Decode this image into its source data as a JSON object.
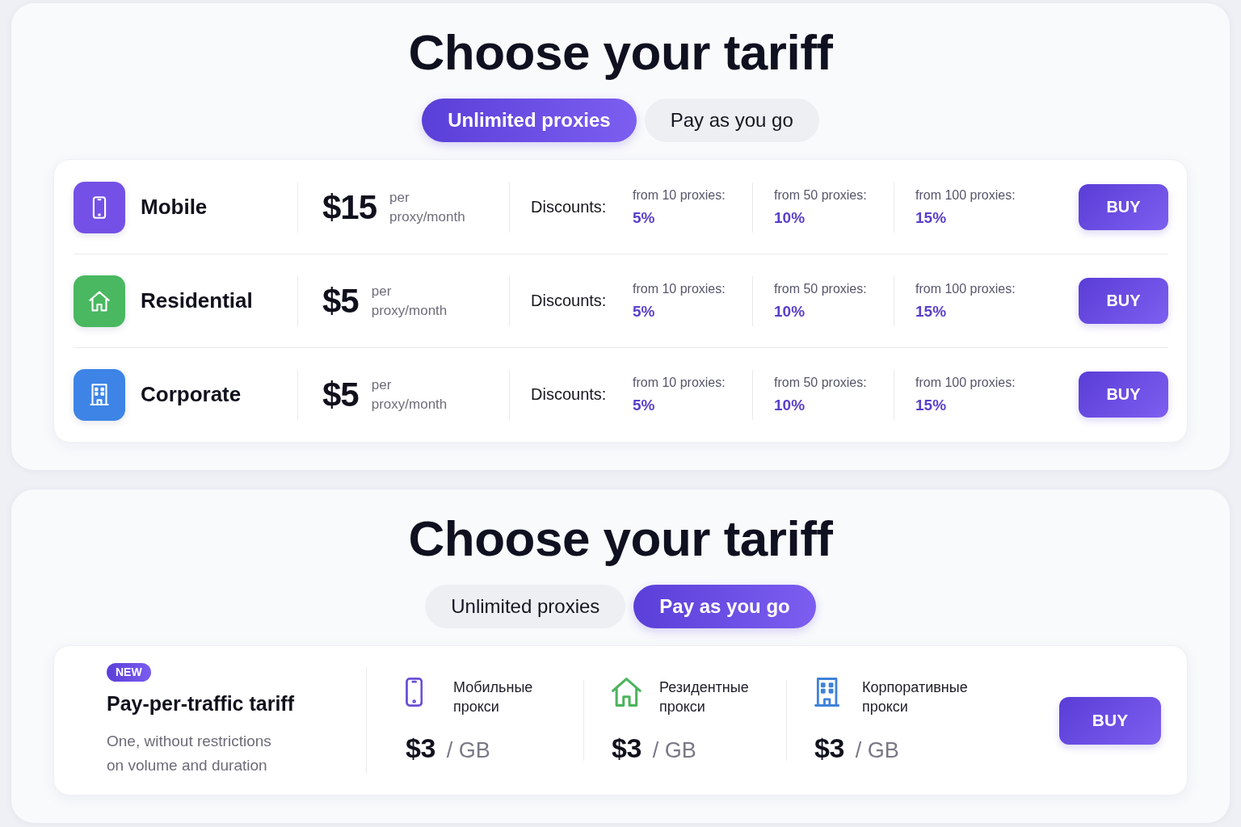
{
  "panels": [
    {
      "title": "Choose your tariff",
      "tabs": [
        {
          "label": "Unlimited proxies",
          "selected": true
        },
        {
          "label": "Pay as you go",
          "selected": false
        }
      ],
      "plans": [
        {
          "kind": "mobile",
          "color": "#7450e6",
          "name": "Mobile",
          "price": "$15",
          "period": "per proxy/month",
          "discounts_label": "Discounts:",
          "discounts": [
            {
              "threshold": "from 10 proxies:",
              "value": "5%"
            },
            {
              "threshold": "from 50 proxies:",
              "value": "10%"
            },
            {
              "threshold": "from 100 proxies:",
              "value": "15%"
            }
          ],
          "button": "BUY"
        },
        {
          "kind": "residential",
          "color": "#49b860",
          "name": "Residential",
          "price": "$5",
          "period": "per proxy/month",
          "discounts_label": "Discounts:",
          "discounts": [
            {
              "threshold": "from 10 proxies:",
              "value": "5%"
            },
            {
              "threshold": "from 50 proxies:",
              "value": "10%"
            },
            {
              "threshold": "from 100 proxies:",
              "value": "15%"
            }
          ],
          "button": "BUY"
        },
        {
          "kind": "corporate",
          "color": "#3d84e6",
          "name": "Corporate",
          "price": "$5",
          "period": "per proxy/month",
          "discounts_label": "Discounts:",
          "discounts": [
            {
              "threshold": "from 10 proxies:",
              "value": "5%"
            },
            {
              "threshold": "from 50 proxies:",
              "value": "10%"
            },
            {
              "threshold": "from 100 proxies:",
              "value": "15%"
            }
          ],
          "button": "BUY"
        }
      ]
    },
    {
      "title": "Choose your tariff",
      "tabs": [
        {
          "label": "Unlimited proxies",
          "selected": false
        },
        {
          "label": "Pay as you go",
          "selected": true
        }
      ],
      "offer": {
        "badge": "NEW",
        "title": "Pay-per-traffic tariff",
        "description": "One, without restrictions on volume and duration",
        "types": [
          {
            "kind": "mobile",
            "color": "#6a4fd6",
            "name": "Мобильные прокси",
            "price": "$3",
            "unit": "/ GB"
          },
          {
            "kind": "residential",
            "color": "#4cb45e",
            "name": "Резидентные прокси",
            "price": "$3",
            "unit": "/ GB"
          },
          {
            "kind": "corporate",
            "color": "#3f82d8",
            "name": "Корпоративные прокси",
            "price": "$3",
            "unit": "/ GB"
          }
        ],
        "button": "BUY"
      }
    }
  ]
}
